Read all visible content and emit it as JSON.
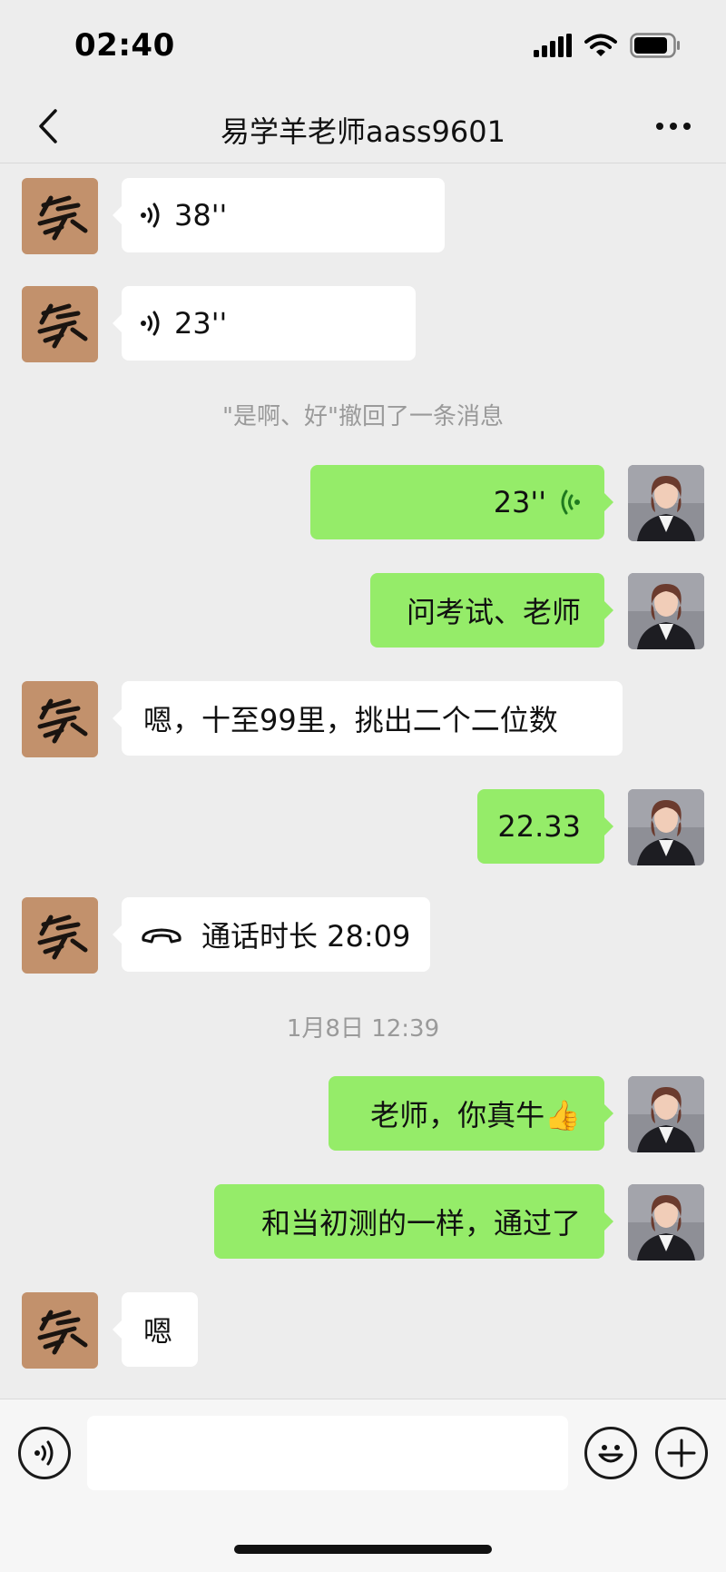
{
  "status_bar": {
    "time": "02:40"
  },
  "header": {
    "title": "易学羊老师aass9601"
  },
  "messages": {
    "m1": {
      "duration": "38''"
    },
    "m2": {
      "duration": "23''"
    },
    "recall": {
      "text": "\"是啊、好\"撤回了一条消息"
    },
    "m3": {
      "duration": "23''"
    },
    "m4": {
      "text": "问考试、老师"
    },
    "m5": {
      "text": "嗯，十至99里，挑出二个二位数"
    },
    "m6": {
      "text": "22.33"
    },
    "m7": {
      "text": "通话时长 28:09"
    },
    "timestamp": {
      "text": "1月8日 12:39"
    },
    "m8": {
      "text": "老师，你真牛👍"
    },
    "m9": {
      "text": "和当初测的一样，通过了"
    },
    "m10": {
      "text": "嗯"
    }
  },
  "icons": {
    "back": "chevron-left-icon",
    "more": "more-dots-icon",
    "voice_in": "voice-wave-icon",
    "voice_out": "voice-wave-icon",
    "call": "phone-handset-icon",
    "voice_input": "voice-input-icon",
    "emoji": "emoji-icon",
    "add": "plus-icon"
  },
  "colors": {
    "background": "#ededed",
    "bubble_out": "#95ec69",
    "bubble_in": "#ffffff",
    "voice_out_icon": "#1f7a1f"
  }
}
